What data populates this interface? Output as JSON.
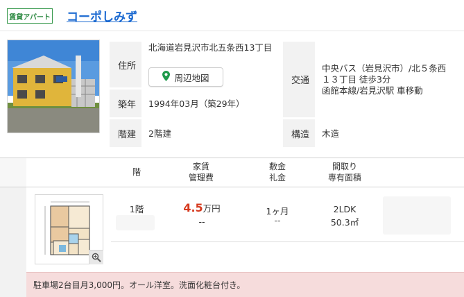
{
  "listing": {
    "category_tag": "賃貸アパート",
    "name": "コーポしみず"
  },
  "details": {
    "address_label": "住所",
    "address_value": "北海道岩見沢市北五条西13丁目",
    "map_button": "周辺地図",
    "built_label": "築年",
    "built_value": "1994年03月（築29年）",
    "floors_label": "階建",
    "floors_value": "2階建",
    "transport_label": "交通",
    "transport_line1": "中央バス（岩見沢市）/北５条西",
    "transport_line2": "１３丁目 徒歩3分",
    "transport_line3": "函館本線/岩見沢駅 車移動",
    "structure_label": "構造",
    "structure_value": "木造"
  },
  "table": {
    "headers": {
      "floor": "階",
      "rent_line1": "家賃",
      "rent_line2": "管理費",
      "deposit_line1": "敷金",
      "deposit_line2": "礼金",
      "layout_line1": "間取り",
      "layout_line2": "専有面積"
    },
    "rows": [
      {
        "floor": "1階",
        "rent_number": "4.5",
        "rent_unit": "万円",
        "management_fee": "--",
        "deposit": "1ヶ月",
        "key_money": "--",
        "layout": "2LDK",
        "area": "50.3㎡"
      }
    ]
  },
  "note": "駐車場2台目月3,000円。オール洋室。洗面化粧台付き。",
  "colors": {
    "tag_green": "#2e8a43",
    "title_blue": "#1c6ad1",
    "rent_red": "#d63a1f",
    "pin_green": "#1f9a4b",
    "note_bg": "#f6dcdc"
  },
  "icons": {
    "map_pin": "map-pin-icon",
    "zoom": "magnifier-icon"
  }
}
